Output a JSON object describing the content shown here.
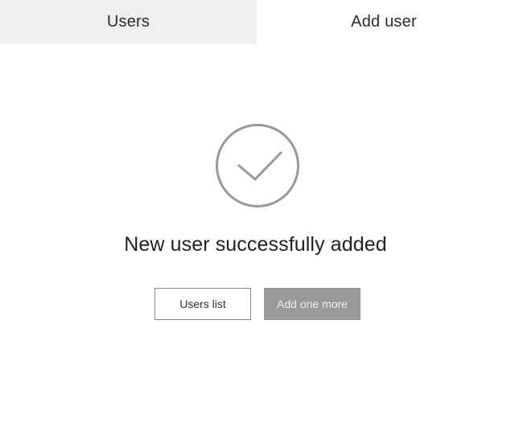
{
  "tabs": {
    "users_label": "Users",
    "add_user_label": "Add user"
  },
  "status": {
    "icon": "check-circle-icon",
    "message": "New user successfully added"
  },
  "actions": {
    "users_list_label": "Users list",
    "add_one_more_label": "Add one more"
  },
  "colors": {
    "inactive_tab_bg": "#efefef",
    "icon_stroke": "#999999",
    "primary_button_bg": "#9a9a9a",
    "secondary_button_border": "#8a8a8a"
  }
}
